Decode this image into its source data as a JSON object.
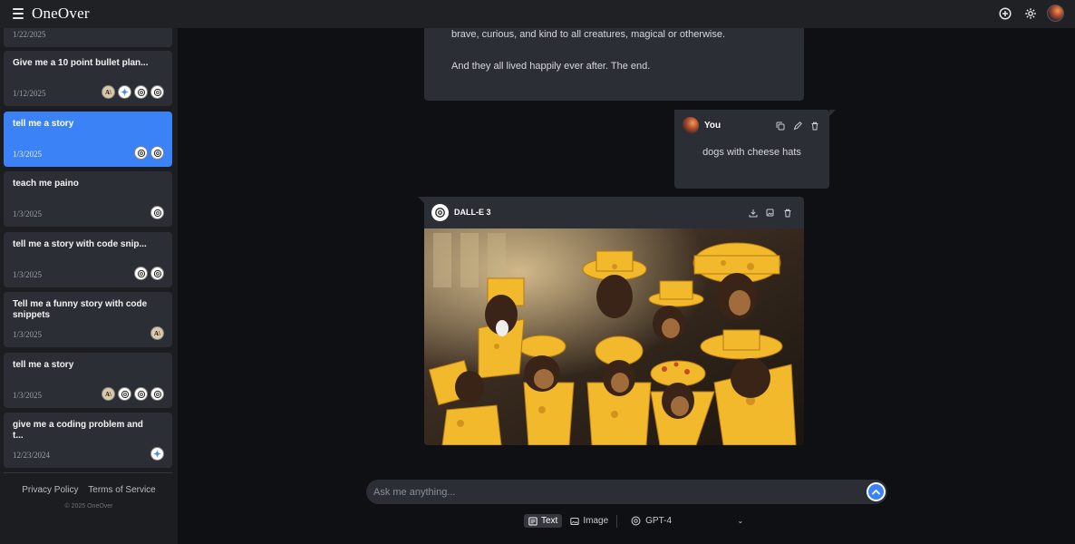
{
  "app": {
    "brand": "OneOver"
  },
  "sidebar": {
    "conversations": [
      {
        "title": "",
        "date": "1/22/2025",
        "models": []
      },
      {
        "title": "Give me a 10 point bullet plan...",
        "date": "1/12/2025",
        "models": [
          "anthropic",
          "gemini",
          "openai",
          "openai"
        ]
      },
      {
        "title": "tell me a story",
        "date": "1/3/2025",
        "models": [
          "openai",
          "openai"
        ],
        "active": true
      },
      {
        "title": "teach me paino",
        "date": "1/3/2025",
        "models": [
          "openai"
        ]
      },
      {
        "title": "tell me a story with code snip...",
        "date": "1/3/2025",
        "models": [
          "openai",
          "openai"
        ]
      },
      {
        "title": "Tell me a funny story with code snippets",
        "date": "1/3/2025",
        "models": [
          "anthropic"
        ]
      },
      {
        "title": "tell me a story",
        "date": "1/3/2025",
        "models": [
          "anthropic",
          "openai",
          "openai",
          "openai"
        ]
      },
      {
        "title": "give me a coding problem and t...",
        "date": "12/23/2024",
        "models": [
          "gemini"
        ]
      }
    ],
    "footer": {
      "privacy": "Privacy Policy",
      "terms": "Terms of Service",
      "copyright": "© 2025 OneOver"
    }
  },
  "chat": {
    "assistant_text": {
      "line1": "brave, curious, and kind to all creatures, magical or otherwise.",
      "line2": "And they all lived happily ever after. The end."
    },
    "user": {
      "name": "You",
      "text": "dogs with cheese hats"
    },
    "image_reply": {
      "model": "DALL-E 3"
    }
  },
  "composer": {
    "placeholder": "Ask me anything...",
    "modes": {
      "text": "Text",
      "image": "Image"
    },
    "model": "GPT-4"
  },
  "colors": {
    "accent": "#3b82f6",
    "panel": "#2b2e34",
    "background": "#0f1013"
  }
}
